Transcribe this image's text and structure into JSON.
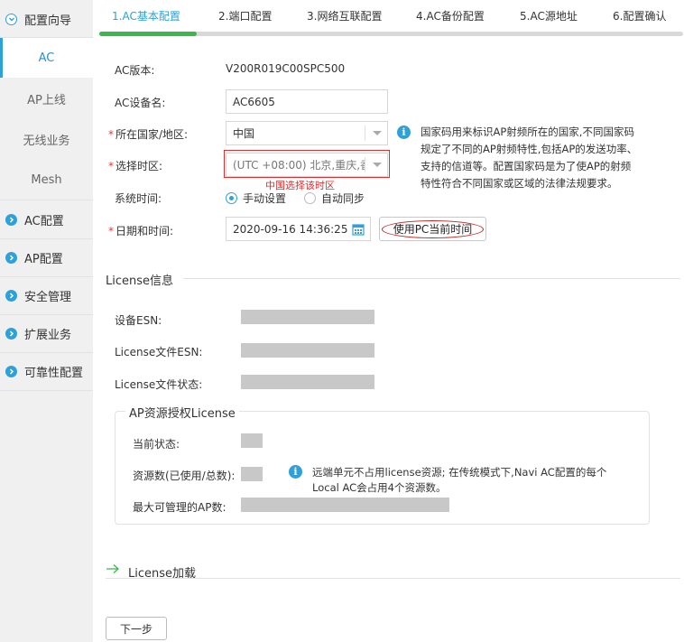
{
  "sidebar": {
    "sections": [
      {
        "label": "配置向导",
        "expanded": true
      },
      {
        "label": "AC配置"
      },
      {
        "label": "AP配置"
      },
      {
        "label": "安全管理"
      },
      {
        "label": "扩展业务"
      },
      {
        "label": "可靠性配置"
      }
    ],
    "sub_items": [
      {
        "label": "AC",
        "active": true
      },
      {
        "label": "AP上线"
      },
      {
        "label": "无线业务"
      },
      {
        "label": "Mesh"
      }
    ]
  },
  "steps": [
    {
      "label": "1.AC基本配置",
      "active": true
    },
    {
      "label": "2.端口配置"
    },
    {
      "label": "3.网络互联配置"
    },
    {
      "label": "4.AC备份配置"
    },
    {
      "label": "5.AC源地址"
    },
    {
      "label": "6.配置确认"
    }
  ],
  "form": {
    "version_label": "AC版本:",
    "version_value": "V200R019C00SPC500",
    "device_name_label": "AC设备名:",
    "device_name_value": "AC6605",
    "country_label": "所在国家/地区:",
    "country_value": "中国",
    "timezone_label": "选择时区:",
    "timezone_value": "(UTC +08:00) 北京,重庆,香",
    "timezone_note": "中国选择该时区",
    "system_time_label": "系统时间:",
    "radio_manual": "手动设置",
    "radio_auto": "自动同步",
    "datetime_label": "日期和时间:",
    "datetime_value": "2020-09-16 14:36:25",
    "use_pc_time": "使用PC当前时间",
    "required_mark": "*",
    "country_info": [
      "国家码用来标识AP射频所在的国家,不同国家码",
      "规定了不同的AP射频特性,包括AP的发送功率、",
      "支持的信道等。配置国家码是为了使AP的射频",
      "特性符合不同国家或区域的法律法规要求。"
    ]
  },
  "license": {
    "title": "License信息",
    "esn_label": "设备ESN:",
    "file_esn_label": "License文件ESN:",
    "file_status_label": "License文件状态:",
    "ap_resource_title": "AP资源授权License",
    "current_status_label": "当前状态:",
    "resource_count_label": "资源数(已使用/总数):",
    "max_ap_label": "最大可管理的AP数:",
    "info_line1": "远端单元不占用license资源; 在传统模式下,Navi AC配置的每个",
    "info_line2": "Local AC会占用4个资源数。",
    "load_title": "License加载"
  },
  "next_button": "下一步",
  "colors": {
    "accent": "#2ea1d8",
    "progress": "#3cb84a",
    "highlight_red": "#d93030"
  },
  "progress_fraction": 0.167
}
